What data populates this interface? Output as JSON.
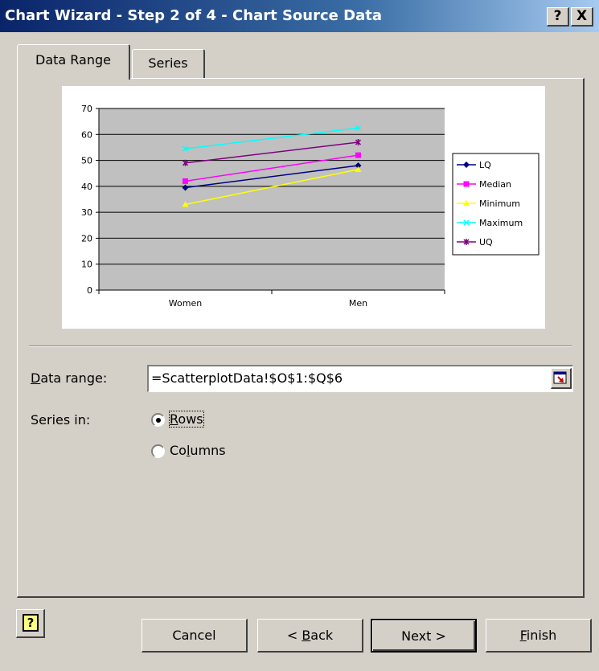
{
  "window": {
    "title": "Chart Wizard - Step 2 of 4 - Chart Source Data",
    "help_glyph": "?",
    "close_glyph": "X"
  },
  "tabs": [
    {
      "label": "Data Range",
      "active": true
    },
    {
      "label": "Series",
      "active": false
    }
  ],
  "chart_data": {
    "type": "line",
    "categories": [
      "Women",
      "Men"
    ],
    "ylim": [
      0,
      70
    ],
    "yticks": [
      "0",
      "10",
      "20",
      "30",
      "40",
      "50",
      "60",
      "70"
    ],
    "grid": true,
    "legend_position": "right",
    "series": [
      {
        "name": "LQ",
        "values": [
          39.5,
          48
        ],
        "color": "#000080",
        "marker": "diamond"
      },
      {
        "name": "Median",
        "values": [
          42,
          52
        ],
        "color": "#ff00ff",
        "marker": "square"
      },
      {
        "name": "Minimum",
        "values": [
          33,
          46.5
        ],
        "color": "#ffff00",
        "marker": "triangle"
      },
      {
        "name": "Maximum",
        "values": [
          54.5,
          62.5
        ],
        "color": "#00ffff",
        "marker": "x"
      },
      {
        "name": "UQ",
        "values": [
          49,
          57
        ],
        "color": "#800080",
        "marker": "star"
      }
    ],
    "plot_background": "#c0c0c0"
  },
  "form": {
    "data_range_label": "Data range:",
    "data_range_value": "=ScatterplotData!$O$1:$Q$6",
    "series_in_label": "Series in:",
    "rows_label": "Rows",
    "columns_label": "Columns",
    "selected": "Rows"
  },
  "buttons": {
    "help_glyph": "?",
    "cancel": "Cancel",
    "back": "< Back",
    "next": "Next >",
    "finish": "Finish"
  }
}
